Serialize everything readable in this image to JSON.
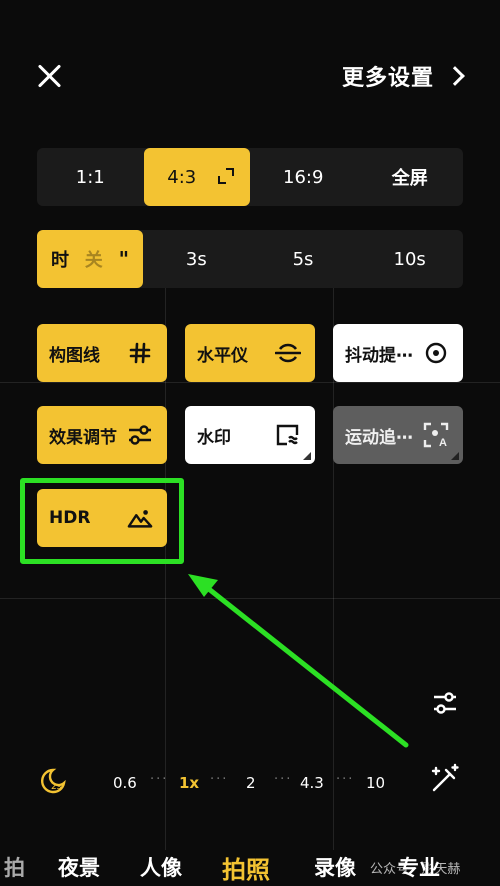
{
  "header": {
    "more_settings": "更多设置"
  },
  "aspect": {
    "options": [
      "1:1",
      "4:3",
      "16:9",
      "全屏"
    ],
    "selected": "4:3"
  },
  "timer": {
    "active_label": "时",
    "active_label2": "关",
    "options": [
      "3s",
      "5s",
      "10s"
    ]
  },
  "tiles": {
    "grid": "构图线",
    "level": "水平仪",
    "shake": "抖动提⋯",
    "effect": "效果调节",
    "watermark": "水印",
    "motion": "运动追⋯",
    "hdr": "HDR"
  },
  "zoom": {
    "levels": [
      "0.6",
      "1x",
      "2",
      "4.3",
      "10"
    ],
    "selected": "1x",
    "night_badge": "2s"
  },
  "modes": {
    "items": [
      "拍",
      "夜景",
      "人像",
      "拍照",
      "录像",
      "专业"
    ],
    "active": "拍照"
  },
  "watermark_text": "公众号 · 影天赫",
  "colors": {
    "accent": "#f3c332",
    "highlight_box": "#2ce024"
  }
}
